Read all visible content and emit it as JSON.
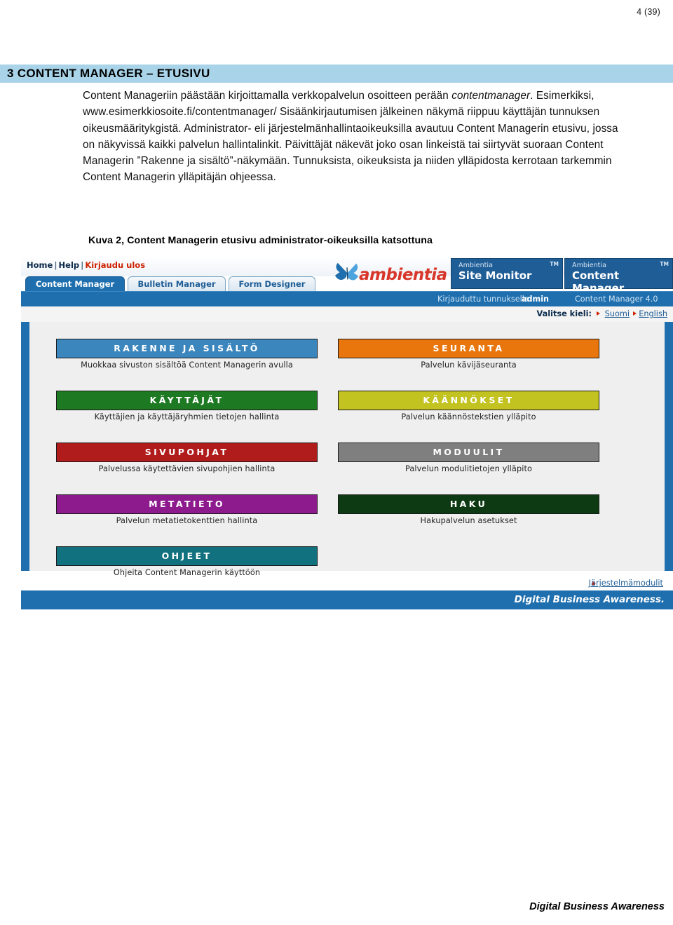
{
  "document": {
    "page_number": "4 (39)",
    "section_heading": "3 CONTENT MANAGER – ETUSIVU",
    "paragraph_parts": {
      "p1": "Content Manageriin päästään kirjoittamalla verkkopalvelun osoitteen perään ",
      "p2_italic": "contentmanager",
      "p3": ". Esimerkiksi, www.esimerkkiosoite.fi/contentmanager/ Sisäänkirjautumisen jälkeinen näkymä riippuu käyttäjän tunnuksen oikeusmääritykgistä. Administrator- eli järjestelmänhallintaoikeuksilla avautuu Content Managerin etusivu, jossa on näkyvissä kaikki palvelun hallintalinkit. Päivittäjät näkevät joko osan linkeistä tai siirtyvät suoraan Content Managerin ”Rakenne ja sisältö”-näkymään. Tunnuksista, oikeuksista ja niiden ylläpidosta kerrotaan tarkemmin Content Managerin ylläpitäjän ohjeessa."
    },
    "figure_caption": "Kuva 2, Content Managerin etusivu administrator-oikeuksilla katsottuna",
    "footer": "Digital Business Awareness"
  },
  "screenshot": {
    "utility": {
      "home": "Home",
      "help": "Help",
      "logout": "Kirjaudu ulos",
      "separator": "|"
    },
    "brand": {
      "wordmark": "ambientia",
      "products": [
        {
          "line1": "Ambientia",
          "line2": "Site Monitor",
          "tm": "TM"
        },
        {
          "line1": "Ambientia",
          "line2": "Content Manager",
          "tm": "TM"
        }
      ]
    },
    "tabs": [
      {
        "label": "Content Manager",
        "active": true
      },
      {
        "label": "Bulletin Manager",
        "active": false
      },
      {
        "label": "Form Designer",
        "active": false
      }
    ],
    "status": {
      "login_prefix": "Kirjauduttu tunnuksella:",
      "username": "admin",
      "version": "Content Manager 4.0"
    },
    "language": {
      "label": "Valitse kieli:",
      "options": [
        "Suomi",
        "English"
      ]
    },
    "tiles": [
      {
        "title": "RAKENNE JA SISÄLTÖ",
        "subtitle": "Muokkaa sivuston sisältöä Content Managerin avulla",
        "color": "#3b86bd"
      },
      {
        "title": "SEURANTA",
        "subtitle": "Palvelun kävijäseuranta",
        "color": "#e8760c"
      },
      {
        "title": "KÄYTTÄJÄT",
        "subtitle": "Käyttäjien ja käyttäjäryhmien tietojen hallinta",
        "color": "#1d7a22"
      },
      {
        "title": "KÄÄNNÖKSET",
        "subtitle": "Palvelun käännöstekstien ylläpito",
        "color": "#c2c220"
      },
      {
        "title": "SIVUPOHJAT",
        "subtitle": "Palvelussa käytettävien sivupohjien hallinta",
        "color": "#b01b1b"
      },
      {
        "title": "MODUULIT",
        "subtitle": "Palvelun modulitietojen ylläpito",
        "color": "#7f7f7f"
      },
      {
        "title": "METATIETO",
        "subtitle": "Palvelun metatietokenttien hallinta",
        "color": "#8e1b8e"
      },
      {
        "title": "HAKU",
        "subtitle": "Hakupalvelun asetukset",
        "color": "#0d3a12"
      },
      {
        "title": "OHJEET",
        "subtitle": "Ohjeita Content Managerin käyttöön",
        "color": "#11717f"
      }
    ],
    "system_modules_link": "Järjestelmämodulit",
    "slogan": "Digital Business Awareness."
  }
}
